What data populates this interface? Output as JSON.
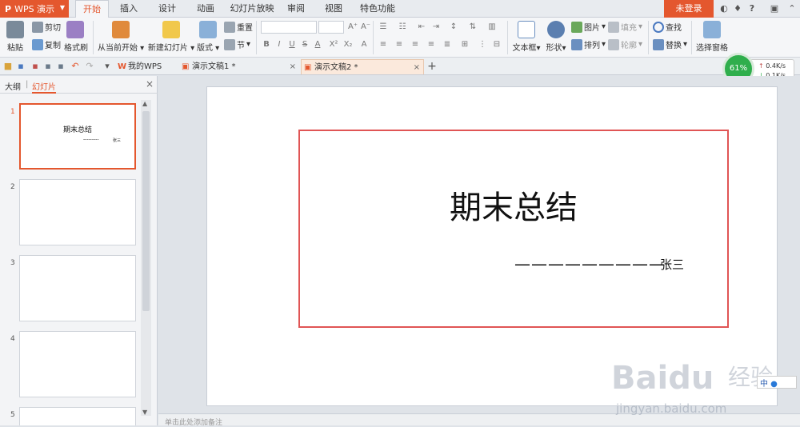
{
  "app": {
    "logo": "P",
    "name": "WPS 演示"
  },
  "menu": {
    "tabs": [
      "开始",
      "插入",
      "设计",
      "动画",
      "幻灯片放映",
      "审阅",
      "视图",
      "特色功能"
    ],
    "active": 0,
    "login": "未登录",
    "help": "?"
  },
  "ribbon": {
    "paste": "粘贴",
    "cut": "剪切",
    "copy": "复制",
    "format_painter": "格式刷",
    "play_from_current": "从当前开始",
    "new_slide": "新建幻灯片",
    "layout": "版式",
    "reset": "重置",
    "section": "节",
    "textbox": "文本框",
    "shape": "形状",
    "picture": "图片",
    "fill": "填充",
    "arrange": "排列",
    "outline": "轮廓",
    "find": "查找",
    "replace": "替换",
    "selection_pane": "选择窗格",
    "font_controls": [
      "B",
      "I",
      "U",
      "S",
      "A",
      "X²",
      "X₂",
      "A⁺",
      "A⁻",
      "A"
    ]
  },
  "doc_tabs": {
    "items": [
      "我的WPS",
      "演示文稿1 *",
      "演示文稿2 *"
    ],
    "active": 2,
    "close": "×",
    "add": "+"
  },
  "speed": {
    "percent": "61%",
    "up": "0.4K/s",
    "down": "0.1K/s"
  },
  "panel": {
    "outline": "大纲",
    "slides": "幻灯片",
    "close": "×",
    "slide_numbers": [
      "1",
      "2",
      "3",
      "4",
      "5"
    ],
    "thumb1_title": "期末总结",
    "thumb1_line": "---------",
    "thumb1_author": "张三"
  },
  "slide": {
    "title": "期末总结",
    "dashes": "—————————",
    "author": "张三"
  },
  "notes": {
    "placeholder": "单击此处添加备注"
  },
  "watermark": {
    "brand": "Baidu",
    "suffix": "经验",
    "url": "jingyan.baidu.com",
    "ime": "中"
  },
  "colors": {
    "accent": "#e4572e",
    "frame": "#e05555",
    "speed_green": "#2fae4c"
  }
}
